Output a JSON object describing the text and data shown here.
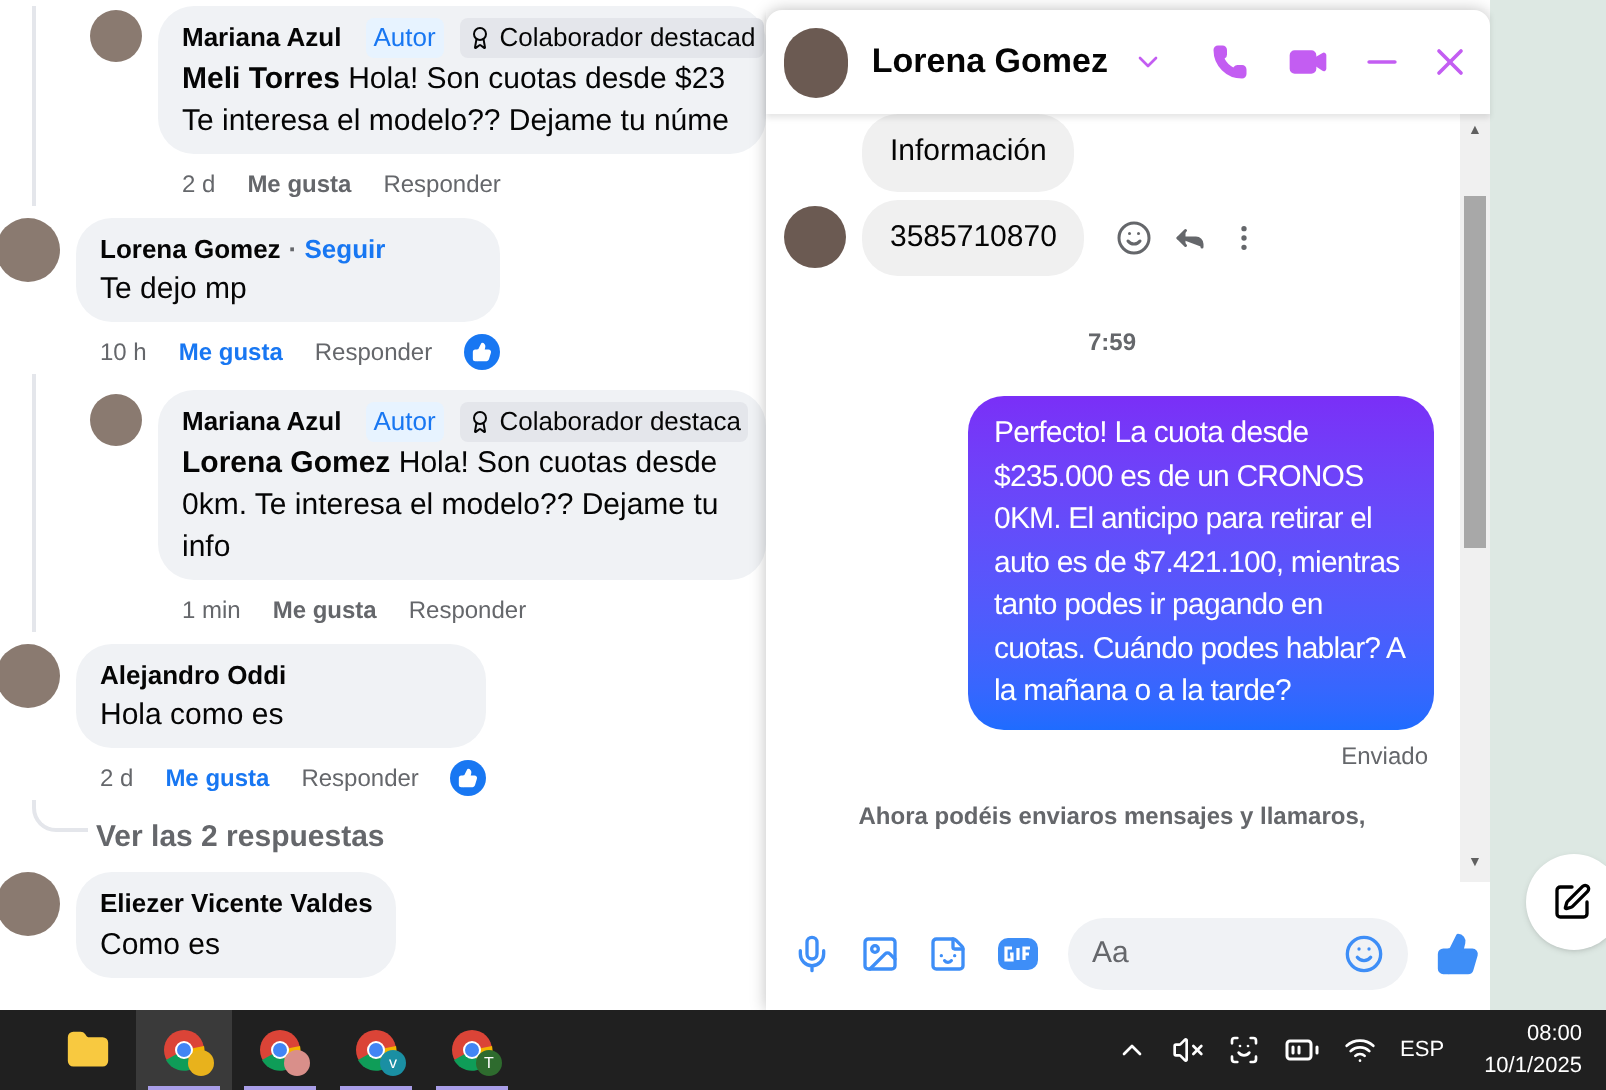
{
  "comments": [
    {
      "kind": "reply",
      "author": "Mariana Azul",
      "tags": [
        "Autor"
      ],
      "badge": "Colaborador destacad",
      "lines": [
        "**Meli Torres** Hola! Son cuotas desde $23",
        "Te interesa el modelo?? Dejame tu núme"
      ],
      "time": "2 d",
      "like": "Me gusta",
      "liked": false,
      "reply": "Responder"
    },
    {
      "kind": "comment",
      "author": "Lorena Gomez",
      "follow_separator": "·",
      "follow": "Seguir",
      "lines": [
        "Te dejo mp"
      ],
      "time": "10 h",
      "like": "Me gusta",
      "liked": true,
      "reply": "Responder",
      "children": [
        {
          "kind": "reply",
          "author": "Mariana Azul",
          "tags": [
            "Autor"
          ],
          "badge": "Colaborador destaca",
          "lines": [
            "**Lorena Gomez** Hola! Son cuotas desde",
            "0km. Te interesa el modelo?? Dejame tu",
            "info"
          ],
          "time": "1 min",
          "like": "Me gusta",
          "liked": false,
          "reply": "Responder"
        }
      ]
    },
    {
      "kind": "comment",
      "author": "Alejandro Oddi",
      "lines": [
        "Hola como es"
      ],
      "time": "2 d",
      "like": "Me gusta",
      "liked": true,
      "reply": "Responder",
      "more_replies": "Ver las 2 respuestas"
    },
    {
      "kind": "comment",
      "author": "Eliezer Vicente Valdes",
      "lines": [
        "Como es"
      ]
    }
  ],
  "chat": {
    "name": "Lorena Gomez",
    "messages": [
      {
        "kind": "incoming",
        "text": "Información",
        "avatar": false
      },
      {
        "kind": "incoming",
        "text": "3585710870",
        "avatar": true
      },
      {
        "kind": "time",
        "text": "7:59"
      },
      {
        "kind": "outgoing",
        "text": "Perfecto! La cuota desde $235.000 es de un CRONOS 0KM. El anticipo para retirar el auto es de $7.421.100, mientras tanto podes ir pagando en cuotas. Cuándo podes hablar? A la mañana o a la tarde?"
      },
      {
        "kind": "status",
        "text": "Enviado"
      },
      {
        "kind": "notice",
        "text": "Ahora podéis enviaros mensajes y llamaros,"
      }
    ],
    "scrollbar": {
      "up": "▲",
      "down": "▼"
    },
    "composer": {
      "placeholder": "Aa"
    }
  },
  "taskbar": {
    "apps": [
      {
        "kind": "folder",
        "selected": false
      },
      {
        "kind": "browser",
        "selected": true,
        "color": "#e8b21c"
      },
      {
        "kind": "browser",
        "selected": false,
        "color": "#d98f8a"
      },
      {
        "kind": "browser",
        "selected": false,
        "badge": "v",
        "color": "#1a8fa3"
      },
      {
        "kind": "browser",
        "selected": false,
        "badge": "T",
        "color": "#2e6b2e"
      }
    ],
    "language": "ESP",
    "time": "08:00",
    "date": "10/1/2025"
  }
}
